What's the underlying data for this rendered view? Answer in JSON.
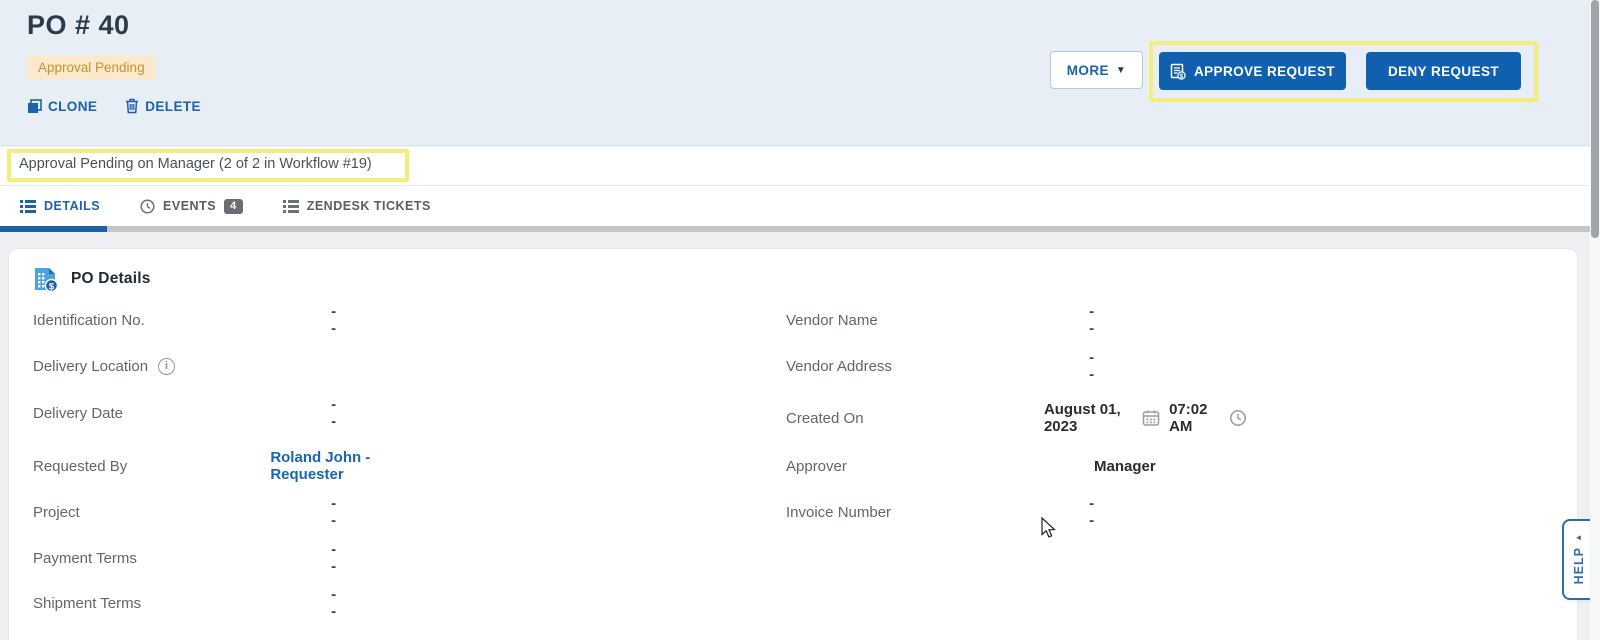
{
  "header": {
    "title": "PO # 40",
    "status_badge": "Approval Pending",
    "clone_label": "CLONE",
    "delete_label": "DELETE",
    "more_label": "MORE",
    "approve_label": "APPROVE REQUEST",
    "deny_label": "DENY REQUEST"
  },
  "workflow_banner": {
    "text": "Approval Pending on Manager (2 of 2 in Workflow #19)"
  },
  "tabs": [
    {
      "label": "DETAILS",
      "active": true
    },
    {
      "label": "EVENTS",
      "badge": "4"
    },
    {
      "label": "ZENDESK TICKETS"
    }
  ],
  "details": {
    "section_title": "PO Details",
    "left": [
      {
        "label": "Identification No.",
        "value": "--"
      },
      {
        "label": "Delivery Location",
        "value": ""
      },
      {
        "label": "Delivery Date",
        "value": "--"
      },
      {
        "label": "Requested By",
        "value": "Roland John - Requester"
      },
      {
        "label": "Project",
        "value": "--"
      },
      {
        "label": "Payment Terms",
        "value": "--"
      },
      {
        "label": "Shipment Terms",
        "value": "--"
      }
    ],
    "right": [
      {
        "label": "Vendor Name",
        "value": "--"
      },
      {
        "label": "Vendor Address",
        "value": "--"
      },
      {
        "label": "Created On",
        "date": "August 01, 2023",
        "time": "07:02 AM"
      },
      {
        "label": "Approver",
        "value": "Manager"
      },
      {
        "label": "Invoice Number",
        "value": "--"
      }
    ]
  },
  "help_tab": {
    "label": "HELP"
  },
  "colors": {
    "accent_blue": "#1b62ab",
    "button_blue": "#1160b0",
    "badge_bg": "#fbe9cd",
    "badge_text": "#c9932d",
    "annotation_yellow": "#f3ee7b",
    "header_bg": "#e8eef6"
  }
}
